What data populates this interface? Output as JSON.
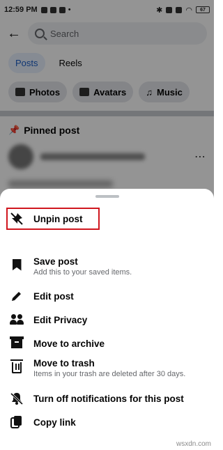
{
  "status_bar": {
    "time": "12:59 PM",
    "battery": "67"
  },
  "background": {
    "search_placeholder": "Search",
    "tabs": [
      {
        "label": "Posts",
        "active": true
      },
      {
        "label": "Reels",
        "active": false
      }
    ],
    "chips": [
      {
        "label": "Photos",
        "icon": "photo-icon"
      },
      {
        "label": "Avatars",
        "icon": "avatar-icon"
      },
      {
        "label": "Music",
        "icon": "music-icon"
      }
    ],
    "pinned_label": "Pinned post"
  },
  "sheet": {
    "items": [
      {
        "label": "Unpin post",
        "sub": "",
        "icon": "unpin-icon",
        "highlighted": true
      },
      {
        "label": "Save post",
        "sub": "Add this to your saved items.",
        "icon": "bookmark-icon"
      },
      {
        "label": "Edit post",
        "sub": "",
        "icon": "pencil-icon"
      },
      {
        "label": "Edit Privacy",
        "sub": "",
        "icon": "people-icon"
      },
      {
        "label": "Move to archive",
        "sub": "",
        "icon": "archive-icon"
      },
      {
        "label": "Move to trash",
        "sub": "Items in your trash are deleted after 30 days.",
        "icon": "trash-icon"
      },
      {
        "label": "Turn off notifications for this post",
        "sub": "",
        "icon": "bell-off-icon"
      },
      {
        "label": "Copy link",
        "sub": "",
        "icon": "copy-icon"
      }
    ]
  },
  "watermark": "wsxdn.com",
  "colors": {
    "highlight_border": "#d0161e",
    "active_tab_text": "#1b5ec7",
    "active_tab_bg": "#e7f0fd"
  }
}
